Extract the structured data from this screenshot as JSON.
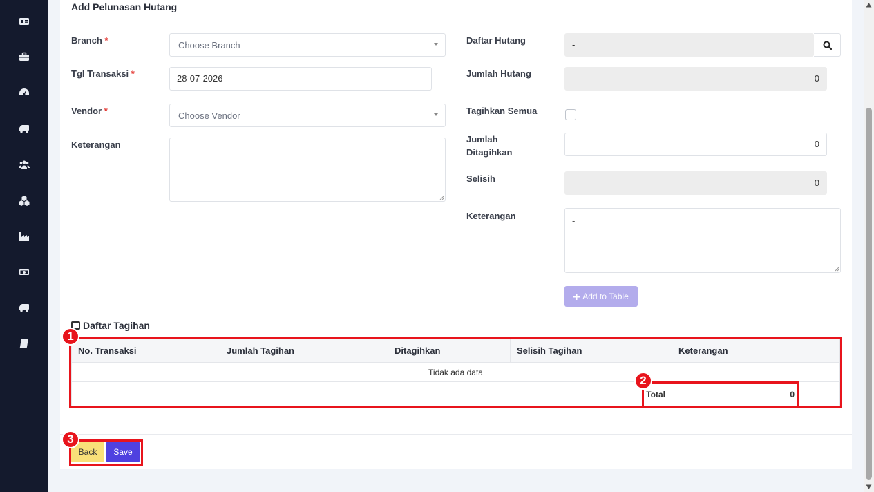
{
  "page": {
    "title": "Add Pelunasan Hutang"
  },
  "sidebar": {
    "icons": [
      "id-card-icon",
      "briefcase-icon",
      "dashboard-icon",
      "truck-icon",
      "users-icon",
      "cubes-icon",
      "factory-icon",
      "money-icon",
      "truck-icon",
      "book-icon"
    ]
  },
  "form_left": {
    "branch": {
      "label": "Branch",
      "required_mark": "*",
      "placeholder": "Choose Branch"
    },
    "tgl_transaksi": {
      "label": "Tgl Transaksi",
      "required_mark": "*",
      "value": "28-07-2026"
    },
    "vendor": {
      "label": "Vendor",
      "required_mark": "*",
      "placeholder": "Choose Vendor"
    },
    "keterangan": {
      "label": "Keterangan",
      "value": ""
    }
  },
  "form_right": {
    "daftar_hutang": {
      "label": "Daftar Hutang",
      "value": "-"
    },
    "jumlah_hutang": {
      "label": "Jumlah Hutang",
      "value": "0"
    },
    "tagihkan_semua": {
      "label": "Tagihkan Semua",
      "checked": false
    },
    "jumlah_ditagihkan": {
      "label_line1": "Jumlah",
      "label_line2": "Ditagihkan",
      "value": "0"
    },
    "selisih": {
      "label": "Selisih",
      "value": "0"
    },
    "keterangan": {
      "label": "Keterangan",
      "value": "-"
    },
    "add_button": {
      "icon": "plus-icon",
      "label": "Add to Table"
    }
  },
  "table": {
    "title": "Daftar Tagihan",
    "columns": [
      "No. Transaksi",
      "Jumlah Tagihan",
      "Ditagihkan",
      "Selisih Tagihan",
      "Keterangan",
      ""
    ],
    "empty_text": "Tidak ada data",
    "total_label": "Total",
    "total_value": "0"
  },
  "footer": {
    "back_label": "Back",
    "save_label": "Save"
  },
  "annotations": {
    "badge1": "1",
    "badge2": "2",
    "badge3": "3",
    "color": "#e8141c"
  }
}
